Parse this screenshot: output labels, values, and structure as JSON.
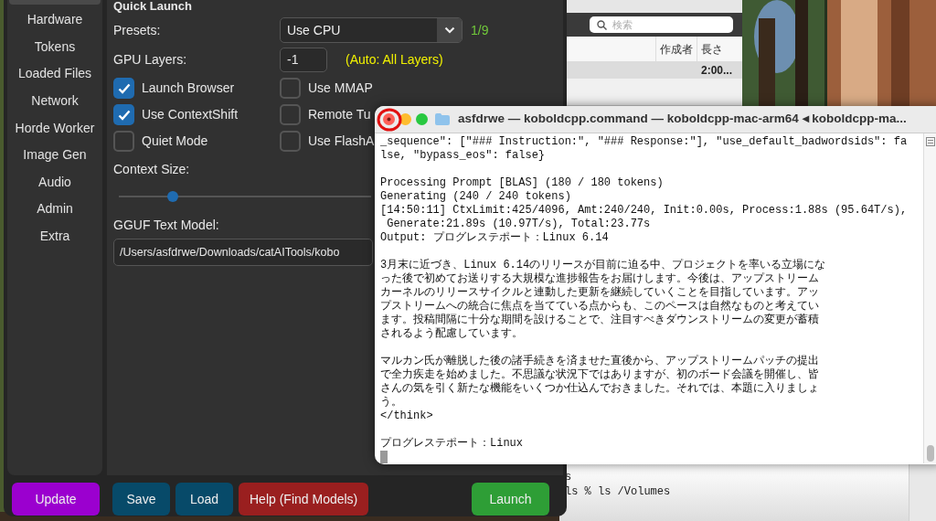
{
  "music_window": {
    "search": {
      "placeholder": "検索"
    },
    "columns": [
      "作成者",
      "長さ"
    ],
    "rows": [
      {
        "selected": true,
        "length": "2:00..."
      }
    ]
  },
  "back_terminal": {
    "lines": [
      "s",
      "ls % ls /Volumes"
    ]
  },
  "kobold": {
    "sidebar": {
      "items": [
        "Hardware",
        "Tokens",
        "Loaded Files",
        "Network",
        "Horde Worker",
        "Image Gen",
        "Audio",
        "Admin",
        "Extra"
      ]
    },
    "heading": "Quick Launch",
    "presets": {
      "label": "Presets:",
      "value": "Use CPU",
      "count": "1/9"
    },
    "gpu_layers": {
      "label": "GPU Layers:",
      "value": "-1",
      "hint": "(Auto: All Layers)"
    },
    "checkboxes": [
      {
        "label": "Launch Browser",
        "checked": true
      },
      {
        "label": "Use MMAP",
        "checked": false
      },
      {
        "label": "Use ContextShift",
        "checked": true
      },
      {
        "label": "Remote Tu",
        "checked": false
      },
      {
        "label": "Quiet Mode",
        "checked": false
      },
      {
        "label": "Use FlashA",
        "checked": false
      }
    ],
    "context_size": {
      "label": "Context Size:",
      "level": 0.2
    },
    "model": {
      "label": "GGUF Text Model:",
      "value": "/Users/asfdrwe/Downloads/catAITools/kobo"
    },
    "buttons": [
      {
        "label": "Update",
        "kind": "update"
      },
      {
        "label": "Save",
        "kind": "file"
      },
      {
        "label": "Load",
        "kind": "file"
      },
      {
        "label": "Help (Find Models)",
        "kind": "help"
      },
      {
        "label": "Launch",
        "kind": "launch"
      }
    ]
  },
  "terminal": {
    "title": "asfdrwe — koboldcpp.command — koboldcpp-mac-arm64 ◂ koboldcpp-ma...",
    "blocks": [
      [
        "_sequence\": [\"### Instruction:\", \"### Response:\"], \"use_default_badwordsids\": fa",
        "lse, \"bypass_eos\": false}"
      ],
      [
        "Processing Prompt [BLAS] (180 / 180 tokens)",
        "Generating (240 / 240 tokens)",
        "[14:50:11] CtxLimit:425/4096, Amt:240/240, Init:0.00s, Process:1.88s (95.64T/s),",
        " Generate:21.89s (10.97T/s), Total:23.77s",
        "Output: プログレステポート：Linux 6.14"
      ],
      [
        "3月末に近づき、Linux 6.14のリリースが目前に迫る中、プロジェクトを率いる立場にな",
        "った後で初めてお送りする大規模な進捗報告をお届けします。今後は、アップストリーム",
        "カーネルのリリースサイクルと連動した更新を継続していくことを目指しています。アッ",
        "プストリームへの統合に焦点を当てている点からも、このペースは自然なものと考えてい",
        "ます。投稿間隔に十分な期間を設けることで、注目すべきダウンストリームの変更が蓄積",
        "されるよう配慮しています。"
      ],
      [
        "マルカン氏が離脱した後の諸手続きを済ませた直後から、アップストリームパッチの提出",
        "で全力疾走を始めました。不思議な状況下ではありますが、初のボード会議を開催し、皆",
        "さんの気を引く新たな機能をいくつか仕込んでおきました。それでは、本題に入りましょ",
        "う。",
        "</think>"
      ],
      [
        "プログレステポート：Linux"
      ]
    ],
    "cursor": true
  }
}
